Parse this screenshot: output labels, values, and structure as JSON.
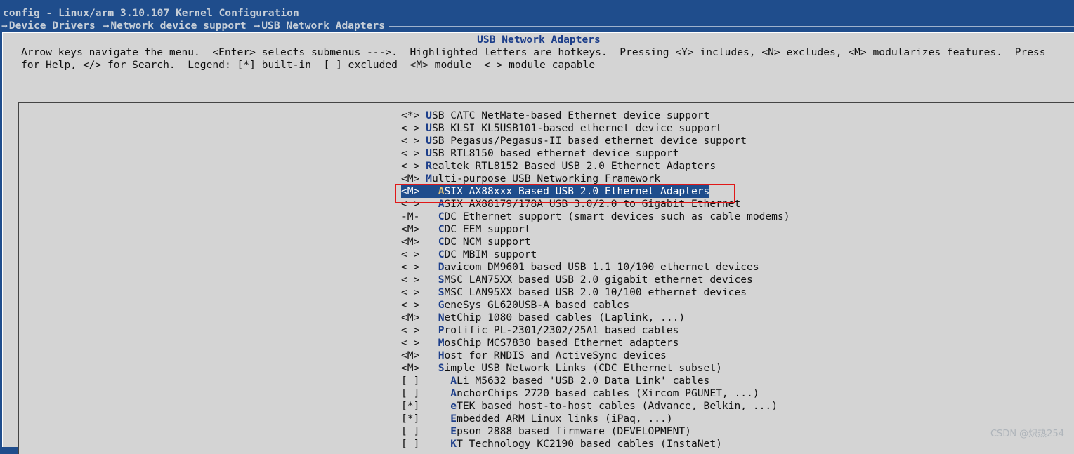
{
  "window": {
    "title": "config - Linux/arm 3.10.107 Kernel Configuration",
    "breadcrumb": [
      "Device Drivers",
      "Network device support",
      "USB Network Adapters"
    ]
  },
  "dialog": {
    "title": "USB Network Adapters",
    "help_line1": "Arrow keys navigate the menu.  <Enter> selects submenus --->.  Highlighted letters are hotkeys.  Pressing <Y> includes, <N> excludes, <M> modularizes features.  Press",
    "help_line2": "for Help, </> for Search.  Legend: [*] built-in  [ ] excluded  <M> module  < > module capable"
  },
  "menu": {
    "selected_index": 6,
    "items": [
      {
        "state": "<*>",
        "indent": " ",
        "hotkey": "U",
        "rest": "SB CATC NetMate-based Ethernet device support"
      },
      {
        "state": "< >",
        "indent": " ",
        "hotkey": "U",
        "rest": "SB KLSI KL5USB101-based ethernet device support"
      },
      {
        "state": "< >",
        "indent": " ",
        "hotkey": "U",
        "rest": "SB Pegasus/Pegasus-II based ethernet device support"
      },
      {
        "state": "< >",
        "indent": " ",
        "hotkey": "U",
        "rest": "SB RTL8150 based ethernet device support"
      },
      {
        "state": "< >",
        "indent": " ",
        "hotkey": "R",
        "rest": "ealtek RTL8152 Based USB 2.0 Ethernet Adapters"
      },
      {
        "state": "<M>",
        "indent": " ",
        "hotkey": "M",
        "rest": "ulti-purpose USB Networking Framework"
      },
      {
        "state": "<M>",
        "indent": "   ",
        "hotkey": "A",
        "rest": "SIX AX88xxx Based USB 2.0 Ethernet Adapters"
      },
      {
        "state": "< >",
        "indent": "   ",
        "hotkey": "A",
        "rest": "SIX AX88179/178A USB 3.0/2.0 to Gigabit Ethernet"
      },
      {
        "state": "-M-",
        "indent": "   ",
        "hotkey": "C",
        "rest": "DC Ethernet support (smart devices such as cable modems)"
      },
      {
        "state": "<M>",
        "indent": "   ",
        "hotkey": "C",
        "rest": "DC EEM support"
      },
      {
        "state": "<M>",
        "indent": "   ",
        "hotkey": "C",
        "rest": "DC NCM support"
      },
      {
        "state": "< >",
        "indent": "   ",
        "hotkey": "C",
        "rest": "DC MBIM support"
      },
      {
        "state": "< >",
        "indent": "   ",
        "hotkey": "D",
        "rest": "avicom DM9601 based USB 1.1 10/100 ethernet devices"
      },
      {
        "state": "< >",
        "indent": "   ",
        "hotkey": "S",
        "rest": "MSC LAN75XX based USB 2.0 gigabit ethernet devices"
      },
      {
        "state": "< >",
        "indent": "   ",
        "hotkey": "S",
        "rest": "MSC LAN95XX based USB 2.0 10/100 ethernet devices"
      },
      {
        "state": "< >",
        "indent": "   ",
        "hotkey": "G",
        "rest": "eneSys GL620USB-A based cables"
      },
      {
        "state": "<M>",
        "indent": "   ",
        "hotkey": "N",
        "rest": "etChip 1080 based cables (Laplink, ...)"
      },
      {
        "state": "< >",
        "indent": "   ",
        "hotkey": "P",
        "rest": "rolific PL-2301/2302/25A1 based cables"
      },
      {
        "state": "< >",
        "indent": "   ",
        "hotkey": "M",
        "rest": "osChip MCS7830 based Ethernet adapters"
      },
      {
        "state": "<M>",
        "indent": "   ",
        "hotkey": "H",
        "rest": "ost for RNDIS and ActiveSync devices"
      },
      {
        "state": "<M>",
        "indent": "   ",
        "hotkey": "S",
        "rest": "imple USB Network Links (CDC Ethernet subset)"
      },
      {
        "state": "[ ]",
        "indent": "     ",
        "hotkey": "A",
        "rest": "Li M5632 based 'USB 2.0 Data Link' cables"
      },
      {
        "state": "[ ]",
        "indent": "     ",
        "hotkey": "A",
        "rest": "nchorChips 2720 based cables (Xircom PGUNET, ...)"
      },
      {
        "state": "[*]",
        "indent": "     ",
        "hotkey": "e",
        "rest": "TEK based host-to-host cables (Advance, Belkin, ...)"
      },
      {
        "state": "[*]",
        "indent": "     ",
        "hotkey": "E",
        "rest": "mbedded ARM Linux links (iPaq, ...)"
      },
      {
        "state": "[ ]",
        "indent": "     ",
        "hotkey": "E",
        "rest": "pson 2888 based firmware (DEVELOPMENT)"
      },
      {
        "state": "[ ]",
        "indent": "     ",
        "hotkey": "K",
        "rest": "T Technology KC2190 based cables (InstaNet)"
      }
    ]
  },
  "watermark": "CSDN @炽热254",
  "colors": {
    "terminal_blue": "#1f4d8c",
    "dialog_gray": "#d4d4d4",
    "hotkey_blue": "#1c3e8a",
    "annotation_red": "#e01818"
  }
}
